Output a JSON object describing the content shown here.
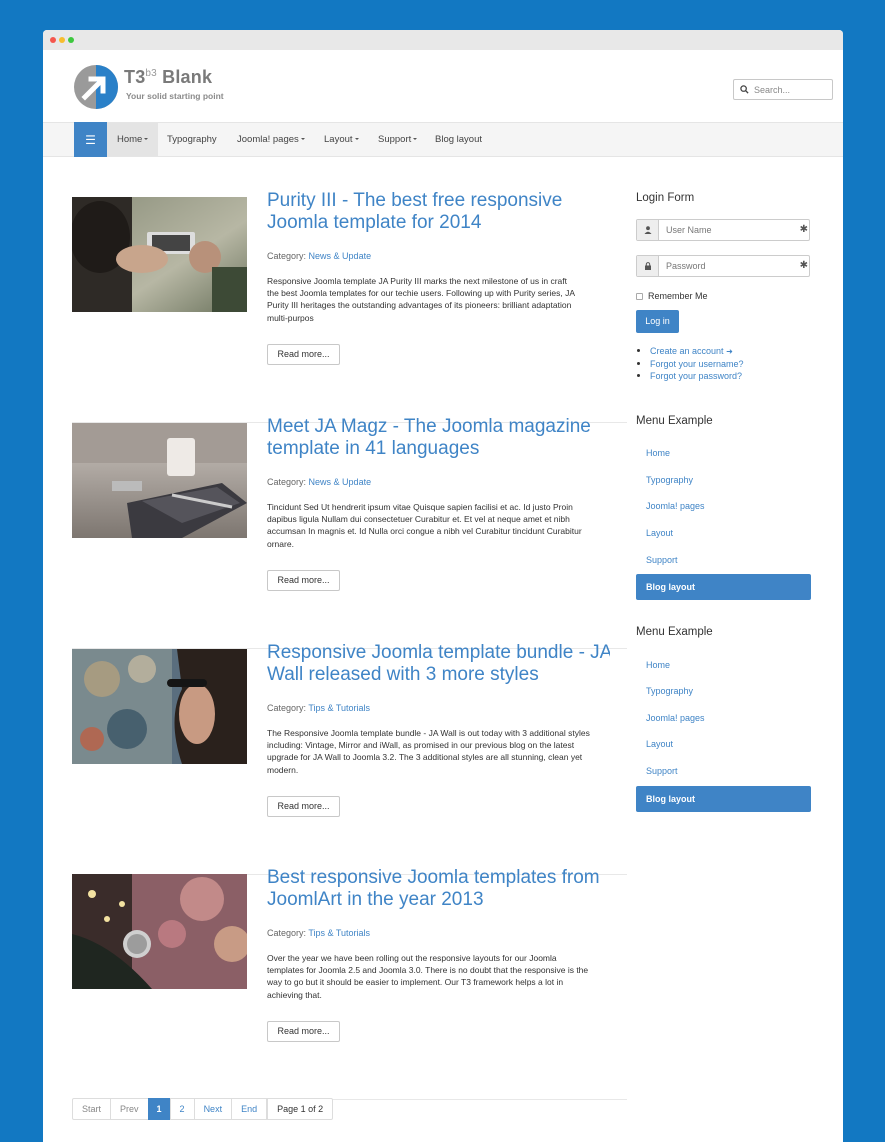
{
  "header": {
    "brand_name": "T3",
    "brand_sup": "b3",
    "brand_suffix": "Blank",
    "tagline": "Your solid starting point",
    "search_placeholder": "Search..."
  },
  "nav": {
    "items": [
      {
        "label": "Home",
        "dropdown": true,
        "active": true
      },
      {
        "label": "Typography",
        "dropdown": false
      },
      {
        "label": "Joomla! pages",
        "dropdown": true
      },
      {
        "label": "Layout",
        "dropdown": true
      },
      {
        "label": "Support",
        "dropdown": true
      },
      {
        "label": "Blog layout",
        "dropdown": false
      }
    ]
  },
  "articles": [
    {
      "title_lines": [
        "Purity III - The best free responsive",
        "Joomla template for 2014"
      ],
      "category_label": "Category:",
      "category": "News & Update",
      "body_lines": [
        "Responsive Joomla template JA Purity III marks the next milestone of us in craft",
        "the best Joomla templates for our techie users. Following up with Purity series, JA",
        "Purity III heritages the outstanding advantages of its pioneers: brilliant adaptation",
        "multi-purpos"
      ],
      "read_more": "Read more..."
    },
    {
      "title_lines": [
        "Meet JA Magz - The Joomla magazine",
        "template in 41 languages"
      ],
      "category_label": "Category:",
      "category": "News & Update",
      "body_lines": [
        "Tincidunt Sed Ut hendrerit ipsum vitae Quisque sapien facilisi et ac. Id justo Proin",
        "dapibus ligula Nullam dui consectetuer Curabitur et. Et vel at neque amet et nibh",
        "accumsan In magnis et. Id Nulla orci congue a nibh vel Curabitur tincidunt Curabitur",
        "ornare."
      ],
      "read_more": "Read more..."
    },
    {
      "title_lines": [
        "Responsive Joomla template bundle - JA",
        "Wall released with 3 more styles"
      ],
      "category_label": "Category:",
      "category": "Tips & Tutorials",
      "body_lines": [
        "The Responsive Joomla template bundle - JA Wall is out today with 3 additional styles",
        "including: Vintage, Mirror and iWall, as promised in our previous blog on the latest",
        "upgrade for JA Wall to Joomla 3.2. The 3 additional styles are all stunning, clean yet",
        "modern."
      ],
      "read_more": "Read more..."
    },
    {
      "title_lines": [
        "Best responsive Joomla templates from",
        "JoomlArt in the year 2013"
      ],
      "category_label": "Category:",
      "category": "Tips & Tutorials",
      "body_lines": [
        "Over the year we have been rolling out the responsive layouts for our Joomla",
        "templates for Joomla 2.5 and Joomla 3.0. There is no doubt that the responsive is the",
        "way to go but it should be easier to implement. Our T3 framework helps a lot in",
        "achieving that."
      ],
      "read_more": "Read more..."
    }
  ],
  "pagination": {
    "start": "Start",
    "prev": "Prev",
    "pages": [
      "1",
      "2"
    ],
    "current": "1",
    "next": "Next",
    "end": "End",
    "info": "Page 1 of 2"
  },
  "sidebar": {
    "login": {
      "heading": "Login Form",
      "username_placeholder": "User Name",
      "password_placeholder": "Password",
      "remember": "Remember Me",
      "button": "Log in",
      "links": [
        "Create an account",
        "Forgot your username?",
        "Forgot your password?"
      ]
    },
    "menus": [
      {
        "heading": "Menu Example",
        "items": [
          "Home",
          "Typography",
          "Joomla! pages",
          "Layout",
          "Support",
          "Blog layout"
        ],
        "active": "Blog layout"
      },
      {
        "heading": "Menu Example",
        "items": [
          "Home",
          "Typography",
          "Joomla! pages",
          "Layout",
          "Support",
          "Blog layout"
        ],
        "active": "Blog layout"
      }
    ]
  },
  "colors": {
    "page_bg": "#1278c2",
    "accent": "#3f84c6",
    "nav_bg": "#f5f5f5"
  }
}
